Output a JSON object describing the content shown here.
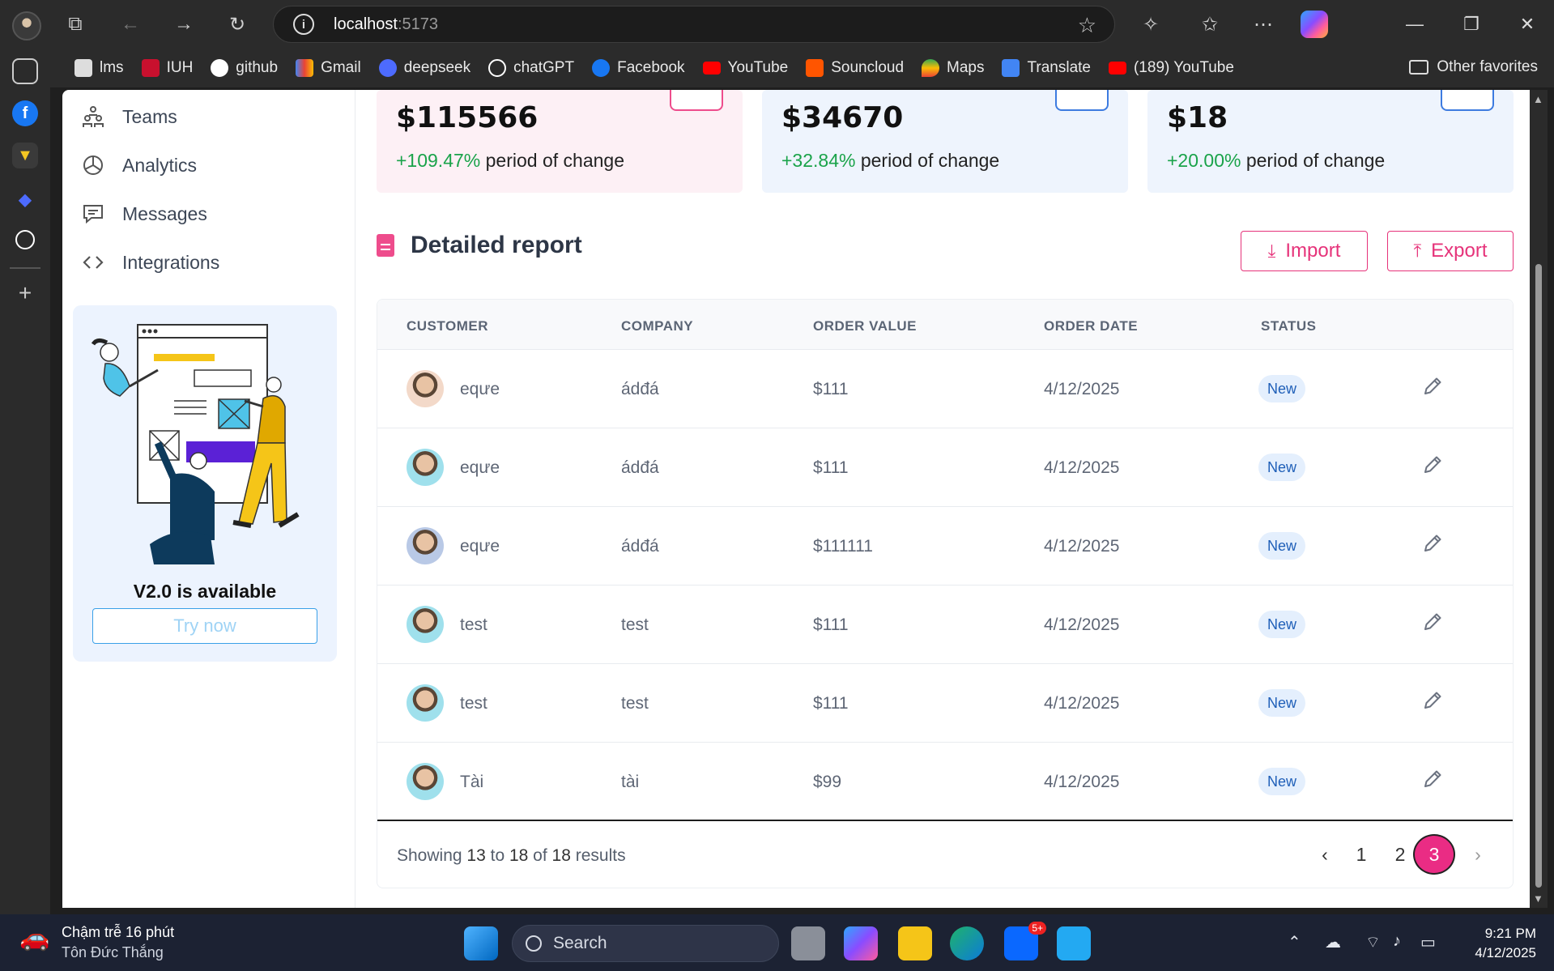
{
  "browser": {
    "url_host": "localhost",
    "url_port": ":5173",
    "bookmarks": [
      "lms",
      "IUH",
      "github",
      "Gmail",
      "deepseek",
      "chatGPT",
      "Facebook",
      "YouTube",
      "Souncloud",
      "Maps",
      "Translate",
      "(189) YouTube"
    ],
    "other_favorites": "Other favorites"
  },
  "sidebar": {
    "items": [
      {
        "label": "Teams",
        "icon": "teams-icon"
      },
      {
        "label": "Analytics",
        "icon": "pie-chart-icon"
      },
      {
        "label": "Messages",
        "icon": "message-icon"
      },
      {
        "label": "Integrations",
        "icon": "code-icon"
      }
    ],
    "promo_title": "V2.0 is available",
    "promo_button": "Try now"
  },
  "stats": [
    {
      "value": "$115566",
      "change": "+109.47%",
      "suffix": "period of change",
      "bg": "#fdf0f5",
      "accent": "#ee4c8c"
    },
    {
      "value": "$34670",
      "change": "+32.84%",
      "suffix": "period of change",
      "bg": "#eef4fd",
      "accent": "#3d7be0"
    },
    {
      "value": "$18",
      "change": "+20.00%",
      "suffix": "period of change",
      "bg": "#eef4fd",
      "accent": "#3d7be0"
    }
  ],
  "report": {
    "title": "Detailed report",
    "import_label": "Import",
    "export_label": "Export",
    "columns": [
      "CUSTOMER",
      "COMPANY",
      "ORDER VALUE",
      "ORDER DATE",
      "STATUS"
    ],
    "rows": [
      {
        "customer": "eqưe",
        "company": "ádđá",
        "value": "$111",
        "date": "4/12/2025",
        "status": "New"
      },
      {
        "customer": "eqưe",
        "company": "ádđá",
        "value": "$111",
        "date": "4/12/2025",
        "status": "New"
      },
      {
        "customer": "eqưe",
        "company": "ádđá",
        "value": "$111111",
        "date": "4/12/2025",
        "status": "New"
      },
      {
        "customer": "test",
        "company": "test",
        "value": "$111",
        "date": "4/12/2025",
        "status": "New"
      },
      {
        "customer": "test",
        "company": "test",
        "value": "$111",
        "date": "4/12/2025",
        "status": "New"
      },
      {
        "customer": "Tài",
        "company": "tài",
        "value": "$99",
        "date": "4/12/2025",
        "status": "New"
      }
    ],
    "footer": {
      "prefix": "Showing",
      "from": "13",
      "to_word": "to",
      "to": "18",
      "of_word": "of",
      "total": "18",
      "suffix": "results"
    },
    "pages": [
      "1",
      "2",
      "3"
    ],
    "current_page": "3",
    "prev": "‹",
    "next": "›"
  },
  "taskbar": {
    "weather_line1": "Chậm trễ 16 phút",
    "weather_line2": "Tôn Đức Thắng",
    "search_label": "Search",
    "time": "9:21 PM",
    "date": "4/12/2025",
    "zalo_badge": "5+"
  }
}
